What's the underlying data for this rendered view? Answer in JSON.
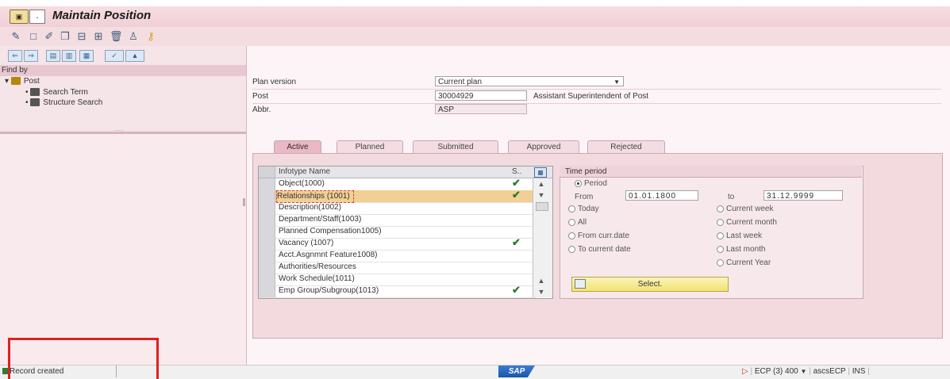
{
  "window": {
    "title": "Maintain Position",
    "menu_glyph": "."
  },
  "toolbar": {
    "icons": [
      "display-icon",
      "create-icon",
      "change-icon",
      "copy-icon",
      "delimit-icon",
      "overview-icon",
      "delete-icon",
      "org-structure-icon",
      "key-icon"
    ]
  },
  "left": {
    "find_by": "Find by",
    "tree": {
      "root": "Post",
      "children": [
        "Search Term",
        "Structure Search"
      ]
    },
    "splitter_text": "......"
  },
  "header": {
    "plan_version_label": "Plan version",
    "plan_version_value": "Current plan",
    "post_label": "Post",
    "post_id": "30004929",
    "post_name": "Assistant Superintendent of Post",
    "abbr_label": "Abbr.",
    "abbr_value": "ASP"
  },
  "tabs": [
    {
      "label": "Active",
      "active": true
    },
    {
      "label": "Planned",
      "active": false
    },
    {
      "label": "Submitted",
      "active": false
    },
    {
      "label": "Approved",
      "active": false
    },
    {
      "label": "Rejected",
      "active": false
    }
  ],
  "infotypes": {
    "col_name": "Infotype Name",
    "col_status": "S..",
    "rows": [
      {
        "name": "Object(1000)",
        "check": "✔",
        "highlight": false
      },
      {
        "name": "Relationships (1001)",
        "check": "✔",
        "highlight": true
      },
      {
        "name": "Description(1002)",
        "check": "",
        "highlight": false
      },
      {
        "name": "Department/Staff(1003)",
        "check": "",
        "highlight": false
      },
      {
        "name": "Planned Compensation1005)",
        "check": "",
        "highlight": false
      },
      {
        "name": "Vacancy (1007)",
        "check": "✔",
        "highlight": false
      },
      {
        "name": "Acct.Asgnmnt Feature1008)",
        "check": "",
        "highlight": false
      },
      {
        "name": "Authorities/Resources",
        "check": "",
        "highlight": false
      },
      {
        "name": "Work Schedule(1011)",
        "check": "",
        "highlight": false
      },
      {
        "name": "Emp Group/Subgroup(1013)",
        "check": "✔",
        "highlight": false
      }
    ]
  },
  "time_period": {
    "title": "Time period",
    "period_label": "Period",
    "from_label": "From",
    "from_value": "01.01.1800",
    "to_label": "to",
    "to_value": "31.12.9999",
    "left_options": [
      "Today",
      "All",
      "From curr.date",
      "To current date"
    ],
    "right_options": [
      "Current week",
      "Current month",
      "Last week",
      "Last month",
      "Current Year"
    ],
    "select_label": "Select."
  },
  "status": {
    "message": "Record created",
    "sap_logo": "SAP",
    "system": "ECP (3) 400",
    "user": "ascsECP",
    "mode": "INS"
  }
}
